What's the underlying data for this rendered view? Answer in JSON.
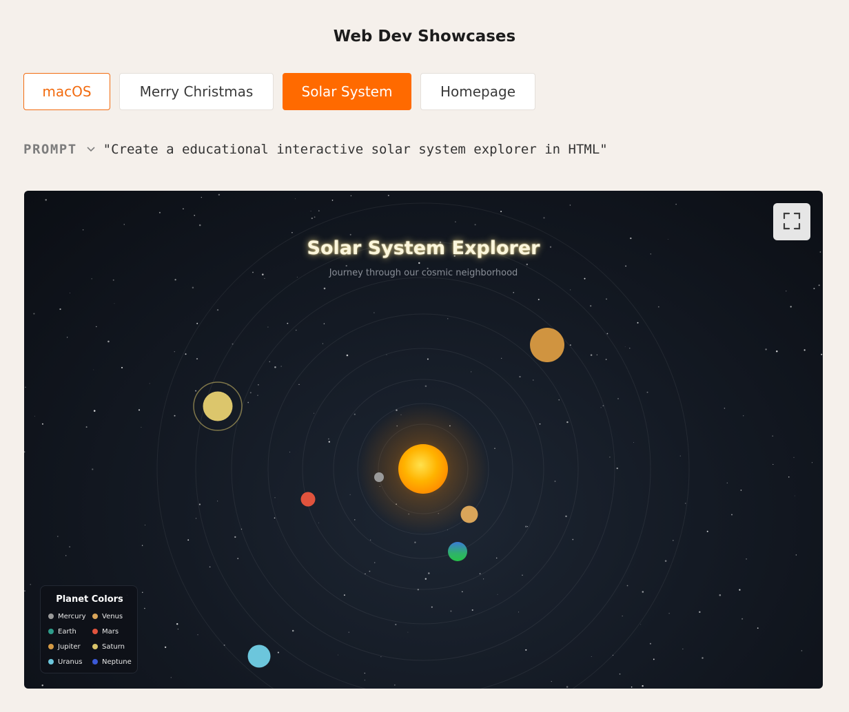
{
  "page": {
    "section_title": "Web Dev Showcases"
  },
  "tabs": [
    {
      "label": "macOS",
      "state": "outlined"
    },
    {
      "label": "Merry Christmas",
      "state": "normal"
    },
    {
      "label": "Solar System",
      "state": "active"
    },
    {
      "label": "Homepage",
      "state": "normal"
    }
  ],
  "prompt": {
    "label": "PROMPT",
    "text": "\"Create a educational interactive solar system explorer in HTML\"",
    "toggle_icon": "chevron-down-icon"
  },
  "preview": {
    "title": "Solar System Explorer",
    "subtitle": "Journey through our cosmic neighborhood",
    "fullscreen_icon": "fullscreen-icon",
    "legend": {
      "title": "Planet Colors",
      "items": [
        {
          "label": "Mercury",
          "color": "#9a9a9a"
        },
        {
          "label": "Venus",
          "color": "#d9a55a"
        },
        {
          "label": "Earth",
          "color": "#2e9c8a"
        },
        {
          "label": "Mars",
          "color": "#e0533d"
        },
        {
          "label": "Jupiter",
          "color": "#d49a45"
        },
        {
          "label": "Saturn",
          "color": "#d9c46a"
        },
        {
          "label": "Uranus",
          "color": "#6cc6dc"
        },
        {
          "label": "Neptune",
          "color": "#3b59d6"
        }
      ]
    }
  },
  "colors": {
    "accent": "#ff6a00",
    "page_background": "#f5f0eb",
    "sun": "#ffb000"
  }
}
